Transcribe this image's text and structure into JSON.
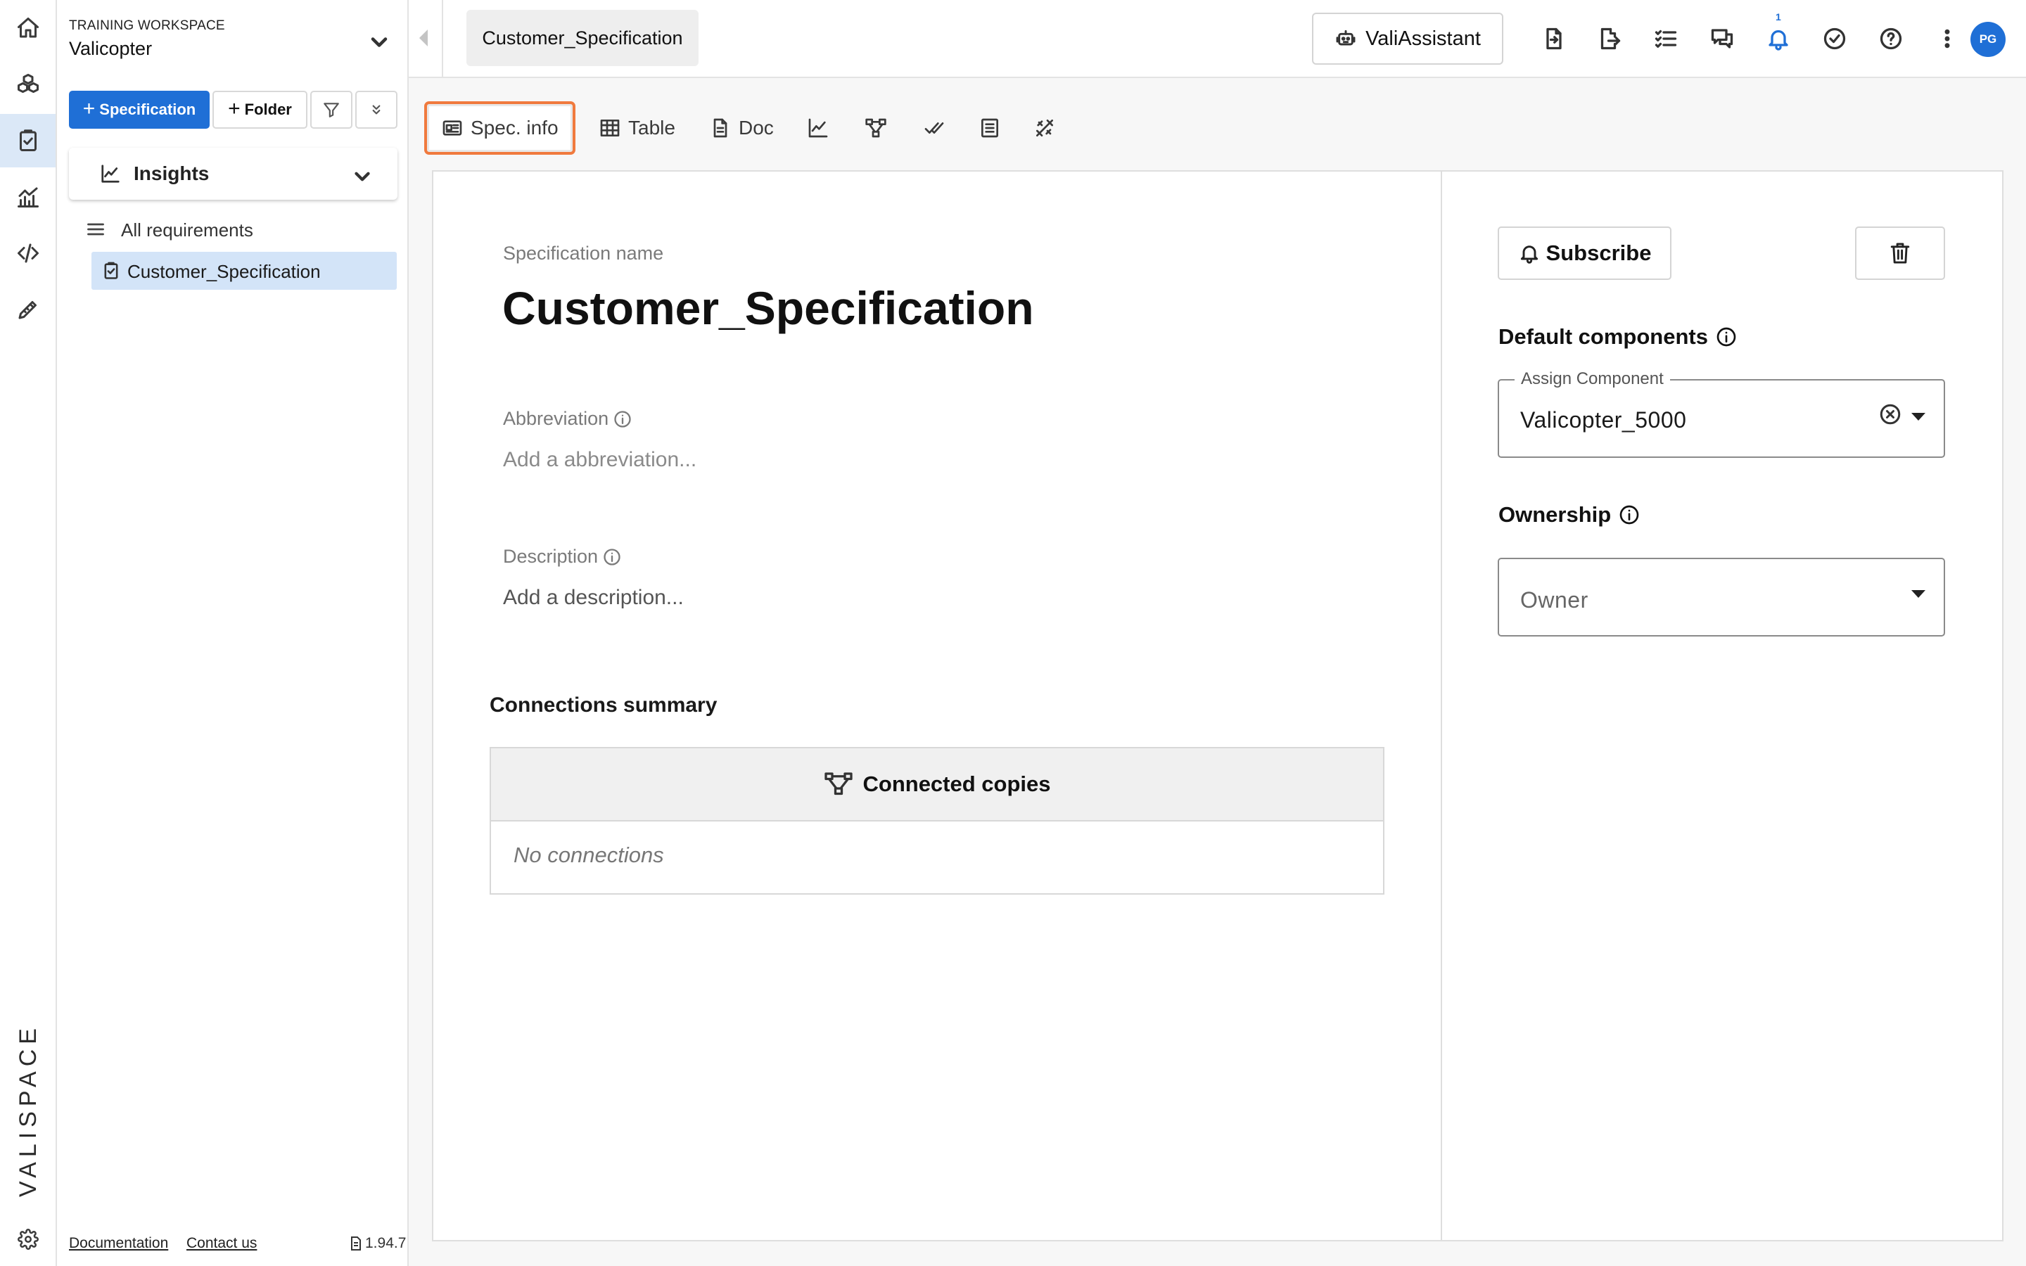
{
  "rail": {
    "items": [
      "home-icon",
      "components-icon",
      "requirements-icon",
      "analysis-icon",
      "code-icon",
      "tools-icon"
    ],
    "active": "requirements-icon",
    "logo_text": "VALISPACE",
    "settings_icon": "gear-icon"
  },
  "sidebar": {
    "workspace_caption": "TRAINING WORKSPACE",
    "workspace_name": "Valicopter",
    "new_spec_label": "Specification",
    "new_folder_label": "Folder",
    "insights_label": "Insights",
    "tree": {
      "all_label": "All requirements",
      "spec_label": "Customer_Specification"
    },
    "footer": {
      "documentation": "Documentation",
      "contact": "Contact us",
      "version": "1.94.7"
    }
  },
  "topbar": {
    "tab_label": "Customer_Specification",
    "assistant_label": "ValiAssistant",
    "notification_count": "1",
    "avatar_initials": "PG",
    "icons": [
      "import-icon",
      "export-icon",
      "checklist-icon",
      "chat-icon",
      "bell-icon",
      "verified-icon",
      "help-icon",
      "more-icon"
    ]
  },
  "viewbar": {
    "spec_info": "Spec. info",
    "table": "Table",
    "doc": "Doc",
    "active": "spec_info",
    "icon_views": [
      "chart-icon",
      "graph-icon",
      "check-icon",
      "list-icon",
      "tools-icon"
    ]
  },
  "spec": {
    "name_label": "Specification name",
    "name": "Customer_Specification",
    "abbreviation_label": "Abbreviation",
    "abbreviation_placeholder": "Add a abbreviation...",
    "description_label": "Description",
    "description_placeholder": "Add a description...",
    "connections": {
      "title": "Connections summary",
      "header": "Connected copies",
      "empty": "No connections"
    }
  },
  "side_panel": {
    "subscribe_label": "Subscribe",
    "default_components_label": "Default components",
    "assign_component_legend": "Assign Component",
    "assign_component_value": "Valicopter_5000",
    "ownership_label": "Ownership",
    "owner_placeholder": "Owner"
  },
  "colors": {
    "accent": "#1f6fd6",
    "highlight": "#f07a3e",
    "selected_bg": "#d3e4f8"
  }
}
